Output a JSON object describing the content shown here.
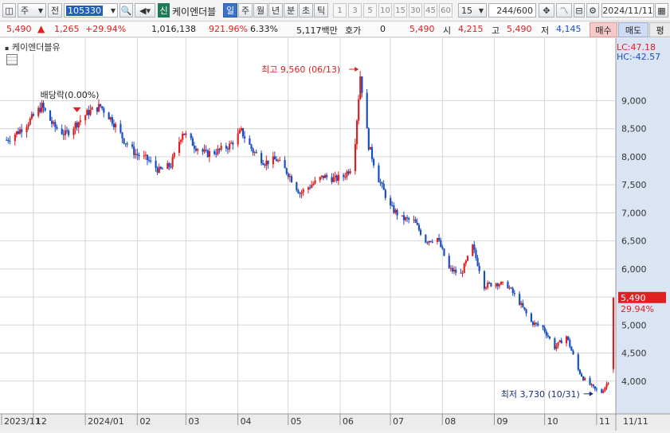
{
  "toolbar": {
    "type_select": "주",
    "prefix": "전",
    "code": "105330",
    "badge": "신",
    "name": "케이엔더블",
    "periods": [
      "일",
      "주",
      "월",
      "년",
      "분",
      "초",
      "틱"
    ],
    "period_active": "일",
    "nums": [
      "1",
      "3",
      "5",
      "10",
      "15",
      "30",
      "45",
      "60"
    ],
    "num_select": "15",
    "count": "244",
    "count_total": "/600",
    "date": "2024/11/11"
  },
  "quote": {
    "price": "5,490",
    "change": "1,265",
    "change_pct": "+29.94%",
    "volume": "1,016,138",
    "volume_ratio": "921.96%",
    "turnover": "6.33%",
    "amount": "5,117백만",
    "hoga_label": "호가",
    "hoga_value": "0",
    "hoga_price": "5,490",
    "open_label": "시",
    "open": "4,215",
    "high_label": "고",
    "high": "5,490",
    "low_label": "저",
    "low": "4,145",
    "buy_label": "매수",
    "sell_label": "매도",
    "eval_label": "평"
  },
  "legend": {
    "stock_name": "케이엔더블유",
    "lc": "LC:47.18",
    "hc": "HC:-42.57"
  },
  "colors": {
    "up": "#e02020",
    "down": "#1a4fc4",
    "grid": "#d6d6d6",
    "plot_bg": "#ffffff",
    "axis_bg": "#dbe4f3"
  },
  "chart_data": {
    "type": "candlestick",
    "ylim": [
      3500,
      10000
    ],
    "yticks": [
      4000,
      4500,
      5000,
      5500,
      6000,
      6500,
      7000,
      7500,
      8000,
      8500,
      9000
    ],
    "ytick_labels": [
      "4,000",
      "4,500",
      "5,000",
      "5,500",
      "6,000",
      "6,500",
      "7,000",
      "7,500",
      "8,000",
      "8,500",
      "9,000"
    ],
    "x_labels": [
      "2023/11",
      "12",
      "2024/01",
      "02",
      "03",
      "04",
      "05",
      "06",
      "07",
      "08",
      "09",
      "10",
      "11",
      "11/11"
    ],
    "price_points": [
      [
        "2023-11-15",
        8300
      ],
      [
        "2023-11-22",
        8450
      ],
      [
        "2023-11-29",
        8650
      ],
      [
        "2023-12-06",
        8900
      ],
      [
        "2023-12-13",
        8550
      ],
      [
        "2023-12-20",
        8400
      ],
      [
        "2023-12-27",
        8600
      ],
      [
        "2024-01-03",
        8800
      ],
      [
        "2024-01-10",
        8900
      ],
      [
        "2024-01-17",
        8650
      ],
      [
        "2024-01-24",
        8300
      ],
      [
        "2024-01-31",
        8050
      ],
      [
        "2024-02-07",
        7950
      ],
      [
        "2024-02-14",
        7750
      ],
      [
        "2024-02-21",
        7850
      ],
      [
        "2024-02-28",
        8450
      ],
      [
        "2024-03-06",
        8200
      ],
      [
        "2024-03-13",
        8050
      ],
      [
        "2024-03-20",
        8100
      ],
      [
        "2024-03-27",
        8200
      ],
      [
        "2024-04-03",
        8450
      ],
      [
        "2024-04-10",
        8100
      ],
      [
        "2024-04-17",
        7900
      ],
      [
        "2024-04-24",
        7950
      ],
      [
        "2024-05-01",
        7700
      ],
      [
        "2024-05-08",
        7350
      ],
      [
        "2024-05-15",
        7500
      ],
      [
        "2024-05-22",
        7650
      ],
      [
        "2024-05-29",
        7600
      ],
      [
        "2024-06-03",
        7650
      ],
      [
        "2024-06-07",
        7800
      ],
      [
        "2024-06-10",
        8300
      ],
      [
        "2024-06-13",
        9450
      ],
      [
        "2024-06-18",
        8200
      ],
      [
        "2024-06-24",
        7600
      ],
      [
        "2024-07-01",
        7100
      ],
      [
        "2024-07-08",
        6900
      ],
      [
        "2024-07-15",
        6850
      ],
      [
        "2024-07-22",
        6500
      ],
      [
        "2024-07-29",
        6550
      ],
      [
        "2024-08-05",
        6000
      ],
      [
        "2024-08-12",
        5900
      ],
      [
        "2024-08-19",
        6400
      ],
      [
        "2024-08-26",
        5700
      ],
      [
        "2024-09-02",
        5750
      ],
      [
        "2024-09-09",
        5700
      ],
      [
        "2024-09-16",
        5400
      ],
      [
        "2024-09-23",
        5050
      ],
      [
        "2024-09-30",
        4950
      ],
      [
        "2024-10-07",
        4600
      ],
      [
        "2024-10-14",
        4800
      ],
      [
        "2024-10-21",
        4200
      ],
      [
        "2024-10-24",
        4050
      ],
      [
        "2024-10-31",
        3850
      ],
      [
        "2024-11-04",
        3800
      ],
      [
        "2024-11-08",
        4000
      ],
      [
        "2024-11-11",
        5490
      ]
    ],
    "annotations": {
      "high": "최고 9,560 (06/13)",
      "low": "최저 3,730 (10/31)",
      "dividend": "배당락(0.00%)",
      "last_price": "5,490",
      "last_pct": "29.94%"
    }
  }
}
